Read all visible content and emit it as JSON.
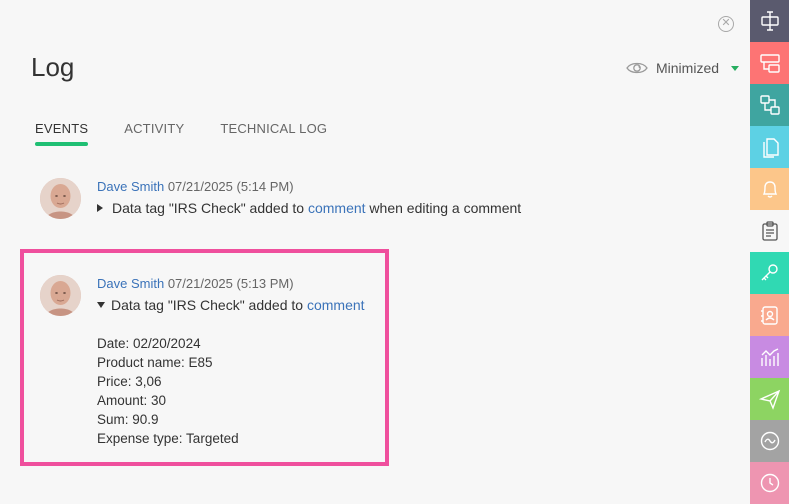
{
  "panel": {
    "title": "Log",
    "close_icon": "close-icon",
    "view_mode": {
      "label": "Minimized",
      "icon": "eye-icon"
    }
  },
  "tabs": [
    {
      "label": "EVENTS",
      "active": true
    },
    {
      "label": "ACTIVITY",
      "active": false
    },
    {
      "label": "TECHNICAL LOG",
      "active": false
    }
  ],
  "entries": [
    {
      "author": "Dave Smith",
      "timestamp": "07/21/2025 (5:14 PM)",
      "expanded": false,
      "message_prefix": "Data tag \"IRS Check\" added to ",
      "message_link": "comment",
      "message_suffix": " when editing a comment"
    },
    {
      "author": "Dave Smith",
      "timestamp": "07/21/2025 (5:13 PM)",
      "expanded": true,
      "message_prefix": "Data tag \"IRS Check\" added to ",
      "message_link": "comment",
      "details": [
        "Date: 02/20/2024",
        "Product name: E85",
        "Price: 3,06",
        "Amount: 30",
        "Sum: 90.9",
        "Expense type: Targeted"
      ]
    }
  ],
  "sidebar": [
    {
      "icon": "text-cursor-icon",
      "color": "#5a5a6e"
    },
    {
      "icon": "layout-blocks-icon",
      "color": "#fd7474"
    },
    {
      "icon": "connect-icon",
      "color": "#3fa5a0"
    },
    {
      "icon": "documents-icon",
      "color": "#5dd1e4"
    },
    {
      "icon": "bell-icon",
      "color": "#fcc68a"
    },
    {
      "icon": "clipboard-icon",
      "color": "#f7f7f7"
    },
    {
      "icon": "key-icon",
      "color": "#30d9b3"
    },
    {
      "icon": "contact-card-icon",
      "color": "#f9a98e"
    },
    {
      "icon": "chart-icon",
      "color": "#c88be2"
    },
    {
      "icon": "paper-plane-icon",
      "color": "#8dd462"
    },
    {
      "icon": "wave-icon",
      "color": "#a3a3a3"
    },
    {
      "icon": "clock-icon",
      "color": "#ee95b1"
    }
  ],
  "colors": {
    "accent": "#1fbf73",
    "link": "#3b73b9",
    "highlight_border": "#ef4f9d",
    "background": "#f7f7f7"
  }
}
